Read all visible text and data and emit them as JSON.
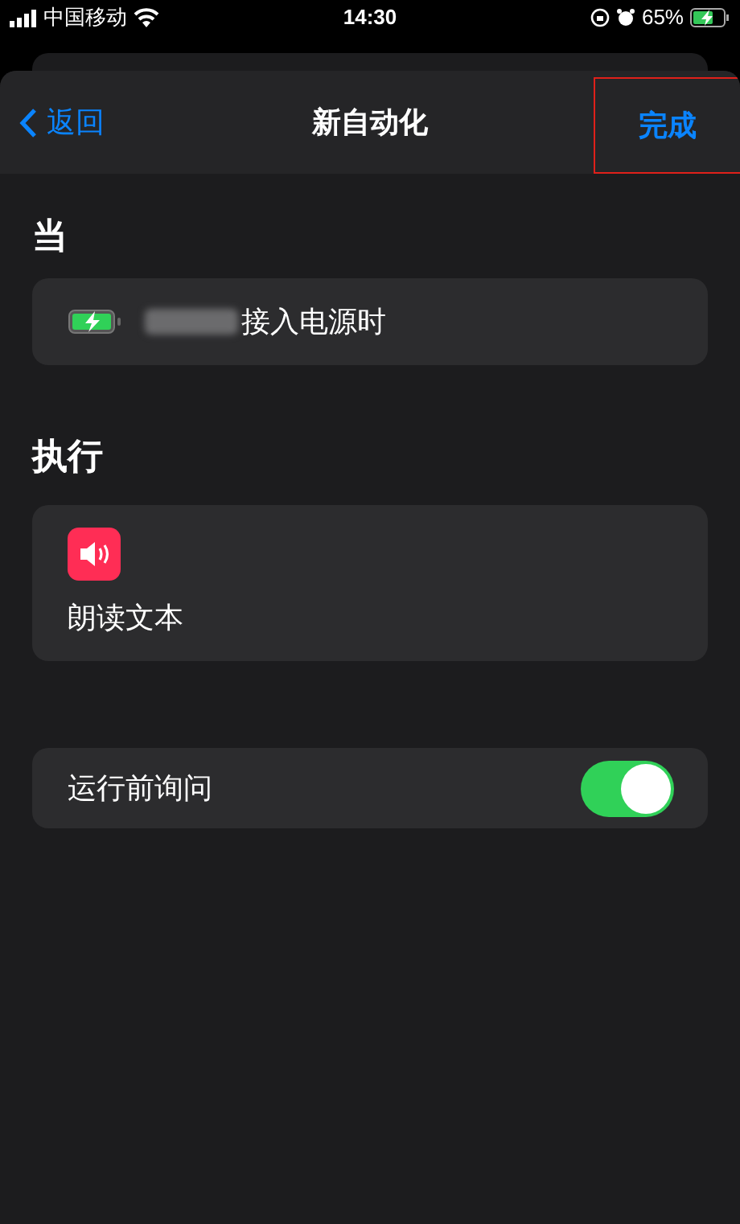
{
  "status_bar": {
    "carrier": "中国移动",
    "time": "14:30",
    "battery_percent": "65%"
  },
  "nav": {
    "back": "返回",
    "title": "新自动化",
    "done": {
      "label": "完成",
      "highlighted": true
    }
  },
  "trigger": {
    "heading": "当",
    "redacted": true,
    "text": "接入电源时"
  },
  "actions": {
    "heading": "执行",
    "items": [
      {
        "label": "朗读文本"
      }
    ]
  },
  "settings": [
    {
      "label": "运行前询问",
      "on": true
    }
  ]
}
